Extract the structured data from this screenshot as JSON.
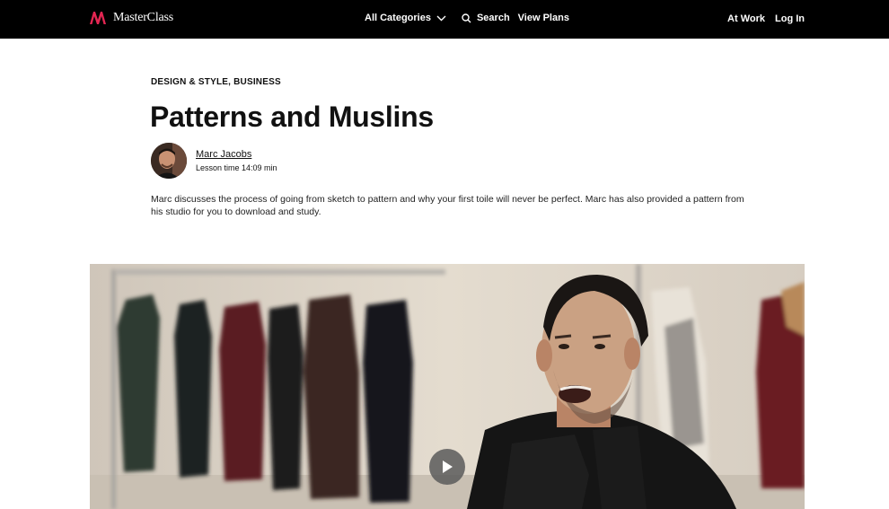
{
  "nav": {
    "logo_text": "MasterClass",
    "all_categories": "All Categories",
    "search": "Search",
    "view_plans": "View Plans",
    "at_work": "At Work",
    "log_in": "Log In"
  },
  "lesson": {
    "category": "DESIGN & STYLE, BUSINESS",
    "title": "Patterns and Muslins",
    "instructor": "Marc Jacobs",
    "lesson_time": "Lesson time 14:09 min",
    "description": "Marc discusses the process of going from sketch to pattern and why your first toile will never be perfect. Marc has also provided a pattern from his studio for you to download and study."
  },
  "colors": {
    "nav_bg": "#000000",
    "brand": "#e32652",
    "text": "#111111"
  },
  "icons": {
    "logo": "masterclass-logo-icon",
    "chevron": "chevron-down-icon",
    "search": "search-icon",
    "play": "play-icon"
  }
}
